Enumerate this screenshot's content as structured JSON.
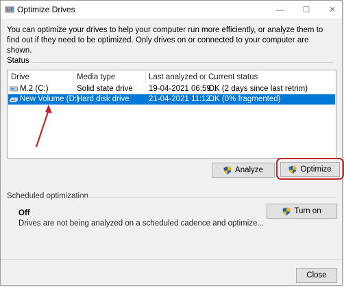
{
  "window": {
    "title": "Optimize Drives",
    "controls": {
      "minimize": "—",
      "maximize": "☐",
      "close": "✕"
    }
  },
  "description": "You can optimize your drives to help your computer run more efficiently, or analyze them to find out if they need to be optimized. Only drives on or connected to your computer are shown.",
  "status": {
    "label": "Status",
    "columns": [
      "Drive",
      "Media type",
      "Last analyzed or ...",
      "Current status"
    ],
    "rows": [
      {
        "drive": "M.2 (C:)",
        "media": "Solid state drive",
        "analyzed": "19-04-2021 06:59...",
        "status": "OK (2 days since last retrim)",
        "selected": false
      },
      {
        "drive": "New Volume (D:)",
        "media": "Hard disk drive",
        "analyzed": "21-04-2021 11:12...",
        "status": "OK (0% fragmented)",
        "selected": true
      }
    ]
  },
  "buttons": {
    "analyze": "Analyze",
    "optimize": "Optimize",
    "turn_on": "Turn on",
    "close": "Close"
  },
  "scheduled": {
    "label": "Scheduled optimization",
    "state": "Off",
    "description": "Drives are not being analyzed on a scheduled cadence and optimize..."
  },
  "colors": {
    "selection": "#0078d7",
    "annotation": "#c2272d",
    "shield_blue": "#1a5fb4",
    "shield_yellow": "#f2b705"
  }
}
